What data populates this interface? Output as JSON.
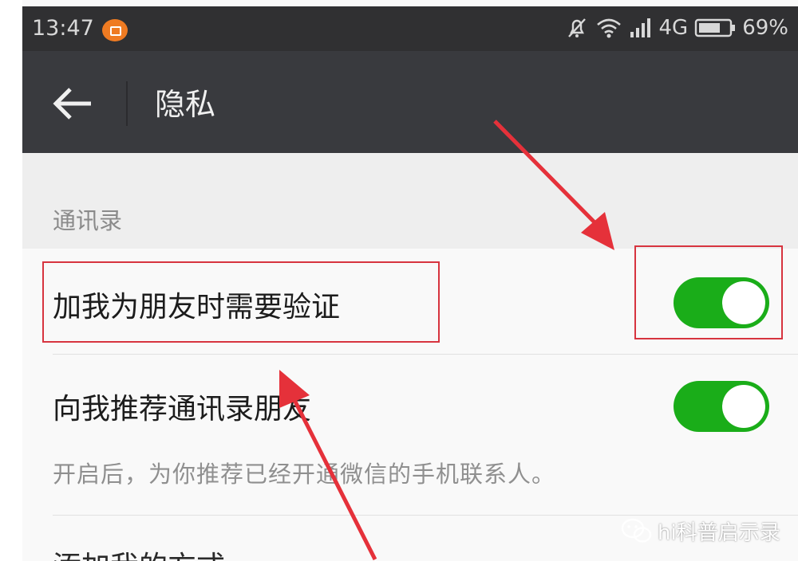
{
  "status_bar": {
    "time": "13:47",
    "network": "4G",
    "battery": "69%"
  },
  "header": {
    "title": "隐私"
  },
  "section": {
    "label": "通讯录"
  },
  "settings": {
    "verify_label": "加我为朋友时需要验证",
    "verify_on": true,
    "recommend_label": "向我推荐通讯录朋友",
    "recommend_on": true,
    "recommend_desc": "开启后，为你推荐已经开通微信的手机联系人。",
    "add_method_label": "添加我的方式"
  },
  "watermark": {
    "text": "hi科普启示录"
  },
  "colors": {
    "toggle_on": "#1aad19",
    "annotation": "#d7343f",
    "appbar": "#393a3e"
  },
  "icons": [
    "notification-icon",
    "mute-bell-icon",
    "wifi-icon",
    "signal-icon",
    "battery-icon",
    "back-arrow-icon",
    "wechat-icon"
  ]
}
